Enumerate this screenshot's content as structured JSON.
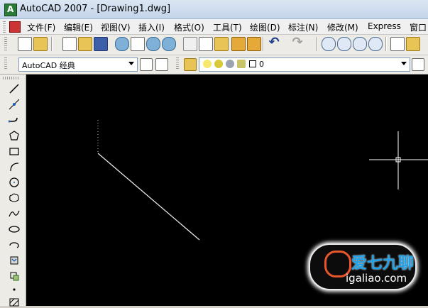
{
  "window": {
    "title": "AutoCAD 2007 - [Drawing1.dwg]"
  },
  "menu": {
    "items": [
      {
        "label": "文件(F)"
      },
      {
        "label": "编辑(E)"
      },
      {
        "label": "视图(V)"
      },
      {
        "label": "插入(I)"
      },
      {
        "label": "格式(O)"
      },
      {
        "label": "工具(T)"
      },
      {
        "label": "绘图(D)"
      },
      {
        "label": "标注(N)"
      },
      {
        "label": "修改(M)"
      },
      {
        "label": "Express"
      },
      {
        "label": "窗口("
      }
    ]
  },
  "workspace": {
    "selected": "AutoCAD 经典"
  },
  "layer": {
    "current": "0"
  },
  "watermark": {
    "brand": "爱七九聊",
    "url": "igaliao.com"
  },
  "colors": {
    "canvas_bg": "#000000",
    "draw_line": "#ffffff",
    "watermark_blue": "#1ea1e8"
  },
  "icons": {
    "standard_toolbar": [
      "new-icon",
      "open-icon",
      "save-icon",
      "plot-icon",
      "plot-preview-icon",
      "publish-icon",
      "cut-icon",
      "copy-icon",
      "paste-icon",
      "match-properties-icon",
      "undo-icon",
      "redo-icon",
      "pan-icon",
      "zoom-realtime-icon",
      "zoom-window-icon",
      "zoom-previous-icon",
      "properties-icon",
      "design-center-icon"
    ],
    "draw_toolbar": [
      "line-icon",
      "construction-line-icon",
      "polyline-icon",
      "polygon-icon",
      "rectangle-icon",
      "arc-icon",
      "circle-icon",
      "revision-cloud-icon",
      "spline-icon",
      "ellipse-icon",
      "ellipse-arc-icon",
      "insert-block-icon",
      "make-block-icon",
      "point-icon",
      "hatch-icon"
    ]
  }
}
